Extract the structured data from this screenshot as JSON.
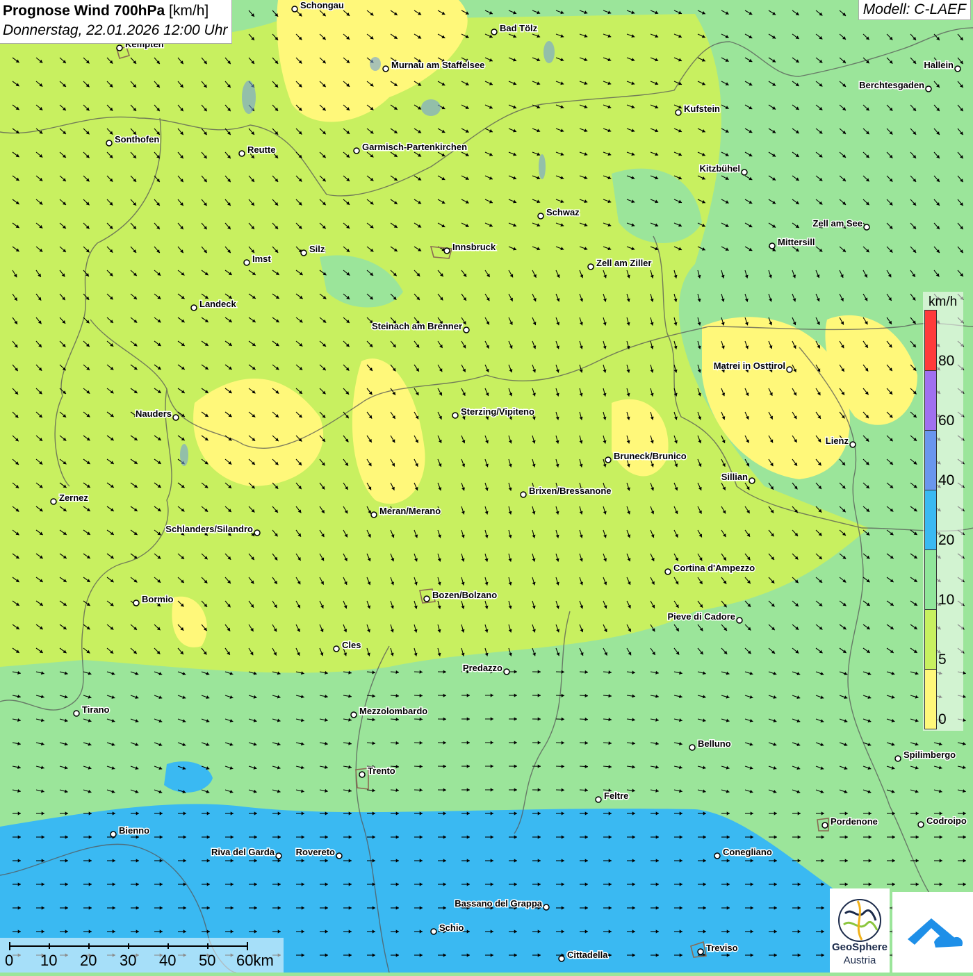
{
  "title": {
    "main": "Prognose Wind 700hPa",
    "unit": "[km/h]",
    "date": "Donnerstag, 22.01.2026 12:00 Uhr"
  },
  "model": "Modell: C-LAEF",
  "legend": {
    "unit": "km/h",
    "ticks": [
      "80",
      "60",
      "40",
      "20",
      "10",
      "5",
      "0"
    ],
    "colors": [
      "#ff3b3b",
      "#a070f0",
      "#6a96ee",
      "#3ab9f2",
      "#90e69a",
      "#c8f060",
      "#fff87a"
    ]
  },
  "scalebar": {
    "labels": [
      "0",
      "10",
      "20",
      "30",
      "40",
      "50",
      "60km"
    ]
  },
  "logo": {
    "name": "GeoSphere",
    "sub": "Austria"
  },
  "cities": [
    {
      "name": "Schongau"
    },
    {
      "name": "Bad Tölz"
    },
    {
      "name": "Kempten"
    },
    {
      "name": "Murnau am Staffelsee"
    },
    {
      "name": "Hallein"
    },
    {
      "name": "Berchtesgaden"
    },
    {
      "name": "Kufstein"
    },
    {
      "name": "Sonthofen"
    },
    {
      "name": "Reutte"
    },
    {
      "name": "Garmisch-Partenkirchen"
    },
    {
      "name": "Kitzbühel"
    },
    {
      "name": "Schwaz"
    },
    {
      "name": "Zell am See"
    },
    {
      "name": "Mittersill"
    },
    {
      "name": "Silz"
    },
    {
      "name": "Imst"
    },
    {
      "name": "Innsbruck"
    },
    {
      "name": "Zell am Ziller"
    },
    {
      "name": "Landeck"
    },
    {
      "name": "Steinach am Brenner"
    },
    {
      "name": "Matrei in Osttirol"
    },
    {
      "name": "Nauders"
    },
    {
      "name": "Sterzing/Vipiteno"
    },
    {
      "name": "Lienz"
    },
    {
      "name": "Bruneck/Brunico"
    },
    {
      "name": "Sillian"
    },
    {
      "name": "Zernez"
    },
    {
      "name": "Brixen/Bressanone"
    },
    {
      "name": "Meran/Merano"
    },
    {
      "name": "Schlanders/Silandro"
    },
    {
      "name": "Cortina d'Ampezzo"
    },
    {
      "name": "Bozen/Bolzano"
    },
    {
      "name": "Bormio"
    },
    {
      "name": "Pieve di Cadore"
    },
    {
      "name": "Cles"
    },
    {
      "name": "Predazzo"
    },
    {
      "name": "Tirano"
    },
    {
      "name": "Mezzolombardo"
    },
    {
      "name": "Belluno"
    },
    {
      "name": "Spilimbergo"
    },
    {
      "name": "Trento"
    },
    {
      "name": "Feltre"
    },
    {
      "name": "Pordenone"
    },
    {
      "name": "Codroipo"
    },
    {
      "name": "Bienno"
    },
    {
      "name": "Riva del Garda"
    },
    {
      "name": "Rovereto"
    },
    {
      "name": "Conegliano"
    },
    {
      "name": "Bassano del Grappa"
    },
    {
      "name": "Schio"
    },
    {
      "name": "Treviso"
    },
    {
      "name": "Cittadella"
    }
  ],
  "wind_classes": {
    "calm": "#fff87a",
    "light": "#c8f060",
    "moderate": "#90e69a",
    "fresh": "#3ab9f2"
  }
}
